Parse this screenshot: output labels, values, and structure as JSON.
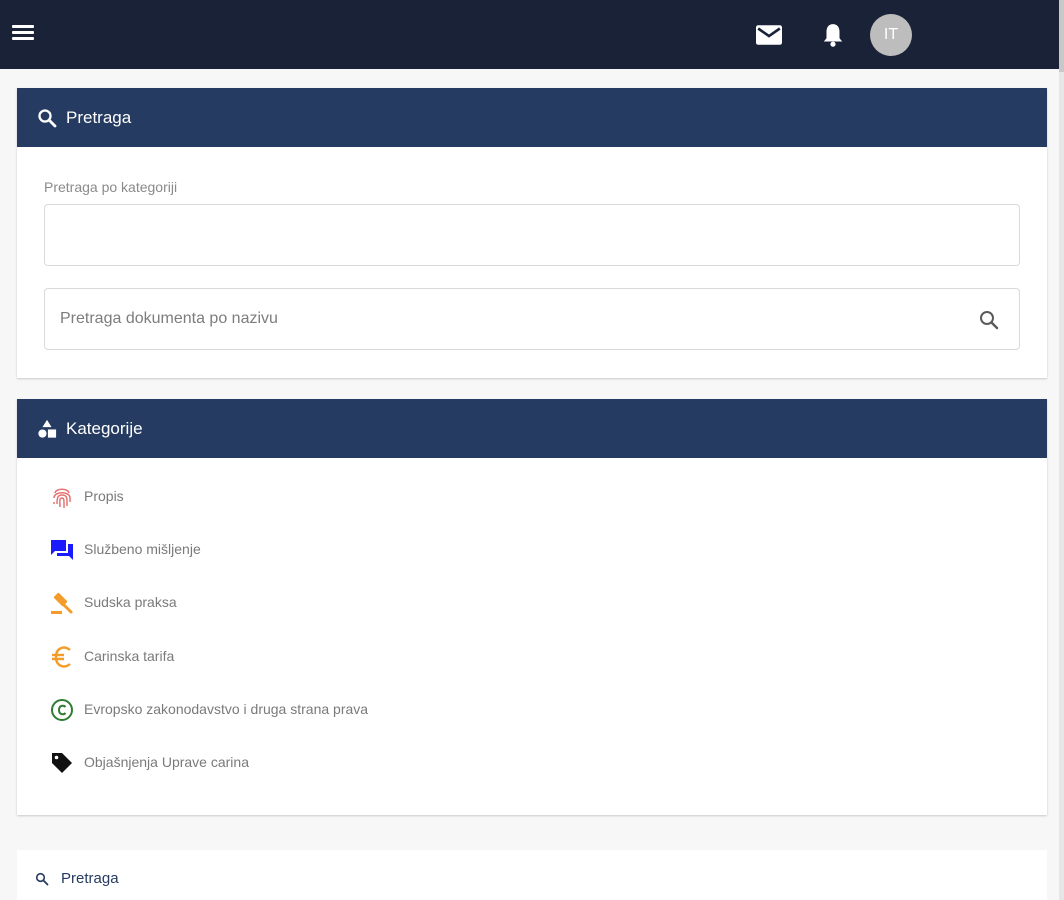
{
  "topbar": {
    "menu_icon": "hamburger-menu-icon",
    "mail_icon": "mail-icon",
    "bell_icon": "bell-icon",
    "avatar_initials": "IT"
  },
  "search_card": {
    "title": "Pretraga",
    "title_icon": "search-icon",
    "category_label": "Pretraga po kategoriji",
    "category_value": "",
    "document_placeholder": "Pretraga dokumenta po nazivu",
    "document_value": "",
    "header_color": "#253b61"
  },
  "categories_card": {
    "title": "Kategorije",
    "title_icon": "shapes-icon",
    "items": [
      {
        "label": "Propis",
        "icon": "fingerprint-icon",
        "color": "#e57373"
      },
      {
        "label": "Službeno mišljenje",
        "icon": "forum-icon",
        "color": "#1a1aff"
      },
      {
        "label": "Sudska praksa",
        "icon": "gavel-icon",
        "color": "#f39c2a"
      },
      {
        "label": "Carinska tarifa",
        "icon": "euro-icon",
        "color": "#f39c2a"
      },
      {
        "label": "Evropsko zakonodavstvo i druga strana prava",
        "icon": "copyright-icon",
        "color": "#2e7d32"
      },
      {
        "label": "Objašnjenja Uprave carina",
        "icon": "tag-icon",
        "color": "#111111"
      }
    ]
  },
  "bottom": {
    "link_label": "Pretraga",
    "link_icon": "search-icon"
  },
  "colors": {
    "topbar": "#1a2238",
    "header": "#253b61",
    "background": "#f7f7f8"
  }
}
